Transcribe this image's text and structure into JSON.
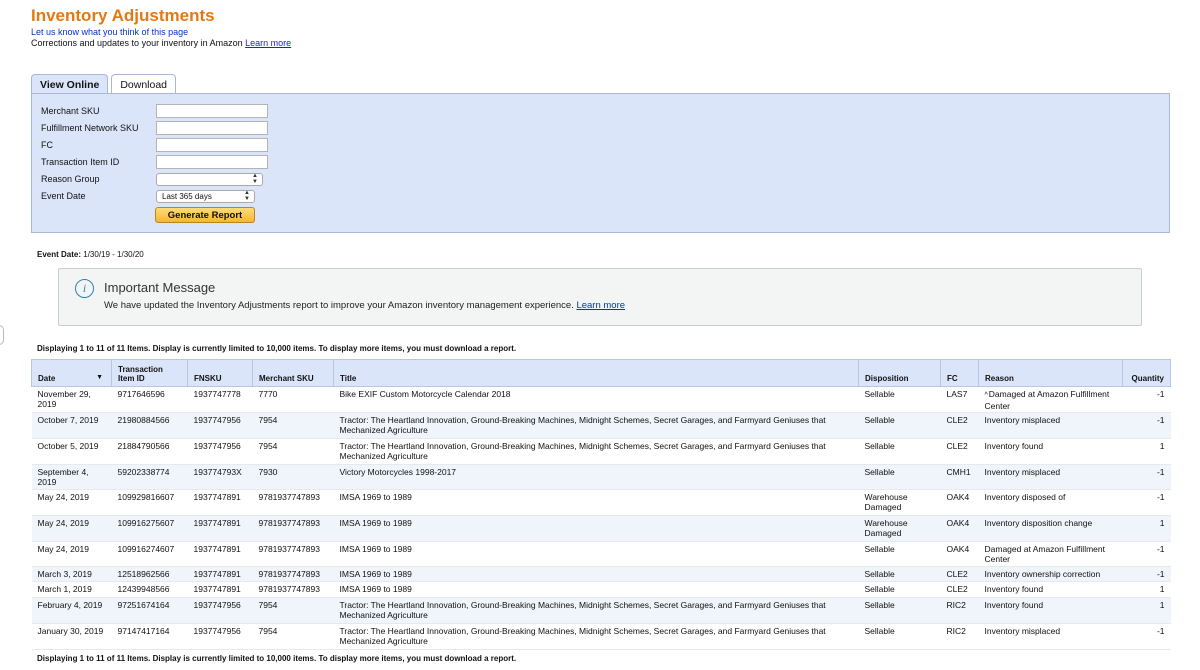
{
  "header": {
    "title": "Inventory Adjustments",
    "feedback_link": "Let us know what you think of this page",
    "subtitle": "Corrections and updates to your inventory in Amazon",
    "subtitle_link": "Learn more"
  },
  "tabs": [
    {
      "label": "View Online",
      "active": true
    },
    {
      "label": "Download",
      "active": false
    }
  ],
  "filters": {
    "merchant_sku_label": "Merchant SKU",
    "fnsku_label": "Fulfillment Network SKU",
    "fc_label": "FC",
    "transaction_item_id_label": "Transaction Item ID",
    "reason_group_label": "Reason Group",
    "reason_group_value": "",
    "event_date_label": "Event Date",
    "event_date_value": "Last 365 days",
    "generate_button": "Generate Report"
  },
  "event_date": {
    "label": "Event Date:",
    "value": "1/30/19 - 1/30/20"
  },
  "message": {
    "title": "Important Message",
    "body": "We have updated the Inventory Adjustments report to improve your Amazon inventory management experience.",
    "link": "Learn more"
  },
  "display_note": "Displaying 1 to 11 of 11 Items. Display is currently limited to 10,000 items. To display more items, you must download a report.",
  "table": {
    "columns": {
      "date": "Date",
      "transaction_item_id": "Transaction Item ID",
      "fnsku": "FNSKU",
      "merchant_sku": "Merchant SKU",
      "title": "Title",
      "disposition": "Disposition",
      "fc": "FC",
      "reason": "Reason",
      "quantity": "Quantity"
    },
    "rows": [
      {
        "date": "November 29, 2019",
        "tid": "9717646596",
        "fnsku": "1937747778",
        "msku": "7770",
        "title": "Bike EXIF Custom Motorcycle Calendar 2018",
        "disposition": "Sellable",
        "fc": "LAS7",
        "reason": "Damaged at Amazon Fulfillment Center",
        "reason_caret": "^",
        "qty": "-1"
      },
      {
        "date": "October 7, 2019",
        "tid": "21980884566",
        "fnsku": "1937747956",
        "msku": "7954",
        "title": "Tractor: The Heartland Innovation, Ground-Breaking Machines, Midnight Schemes, Secret Garages, and Farmyard Geniuses that Mechanized Agriculture",
        "disposition": "Sellable",
        "fc": "CLE2",
        "reason": "Inventory misplaced",
        "reason_caret": "",
        "qty": "-1"
      },
      {
        "date": "October 5, 2019",
        "tid": "21884790566",
        "fnsku": "1937747956",
        "msku": "7954",
        "title": "Tractor: The Heartland Innovation, Ground-Breaking Machines, Midnight Schemes, Secret Garages, and Farmyard Geniuses that Mechanized Agriculture",
        "disposition": "Sellable",
        "fc": "CLE2",
        "reason": "Inventory found",
        "reason_caret": "",
        "qty": "1"
      },
      {
        "date": "September 4, 2019",
        "tid": "59202338774",
        "fnsku": "193774793X",
        "msku": "7930",
        "title": "Victory Motorcycles 1998-2017",
        "disposition": "Sellable",
        "fc": "CMH1",
        "reason": "Inventory misplaced",
        "reason_caret": "",
        "qty": "-1"
      },
      {
        "date": "May 24, 2019",
        "tid": "109929816607",
        "fnsku": "1937747891",
        "msku": "9781937747893",
        "title": "IMSA 1969 to 1989",
        "disposition": "Warehouse Damaged",
        "fc": "OAK4",
        "reason": "Inventory disposed of",
        "reason_caret": "",
        "qty": "-1"
      },
      {
        "date": "May 24, 2019",
        "tid": "109916275607",
        "fnsku": "1937747891",
        "msku": "9781937747893",
        "title": "IMSA 1969 to 1989",
        "disposition": "Warehouse Damaged",
        "fc": "OAK4",
        "reason": "Inventory disposition change",
        "reason_caret": "",
        "qty": "1"
      },
      {
        "date": "May 24, 2019",
        "tid": "109916274607",
        "fnsku": "1937747891",
        "msku": "9781937747893",
        "title": "IMSA 1969 to 1989",
        "disposition": "Sellable",
        "fc": "OAK4",
        "reason": "Damaged at Amazon Fulfillment Center",
        "reason_caret": "",
        "qty": "-1"
      },
      {
        "date": "March 3, 2019",
        "tid": "12518962566",
        "fnsku": "1937747891",
        "msku": "9781937747893",
        "title": "IMSA 1969 to 1989",
        "disposition": "Sellable",
        "fc": "CLE2",
        "reason": "Inventory ownership correction",
        "reason_caret": "",
        "qty": "-1"
      },
      {
        "date": "March 1, 2019",
        "tid": "12439948566",
        "fnsku": "1937747891",
        "msku": "9781937747893",
        "title": "IMSA 1969 to 1989",
        "disposition": "Sellable",
        "fc": "CLE2",
        "reason": "Inventory found",
        "reason_caret": "",
        "qty": "1"
      },
      {
        "date": "February 4, 2019",
        "tid": "97251674164",
        "fnsku": "1937747956",
        "msku": "7954",
        "title": "Tractor: The Heartland Innovation, Ground-Breaking Machines, Midnight Schemes, Secret Garages, and Farmyard Geniuses that Mechanized Agriculture",
        "disposition": "Sellable",
        "fc": "RIC2",
        "reason": "Inventory found",
        "reason_caret": "",
        "qty": "1"
      },
      {
        "date": "January 30, 2019",
        "tid": "97147417164",
        "fnsku": "1937747956",
        "msku": "7954",
        "title": "Tractor: The Heartland Innovation, Ground-Breaking Machines, Midnight Schemes, Secret Garages, and Farmyard Geniuses that Mechanized Agriculture",
        "disposition": "Sellable",
        "fc": "RIC2",
        "reason": "Inventory misplaced",
        "reason_caret": "",
        "qty": "-1"
      }
    ]
  },
  "icons": {
    "info": "info-icon",
    "sort_desc": "sort-desc-icon",
    "select_arrows": "select-arrows-icon"
  },
  "colors": {
    "title_orange": "#e47911",
    "link_blue": "#0033cc",
    "panel_blue": "#dbe5fa",
    "button_gold": "#f5b731",
    "info_blue": "#2f7ec7"
  }
}
